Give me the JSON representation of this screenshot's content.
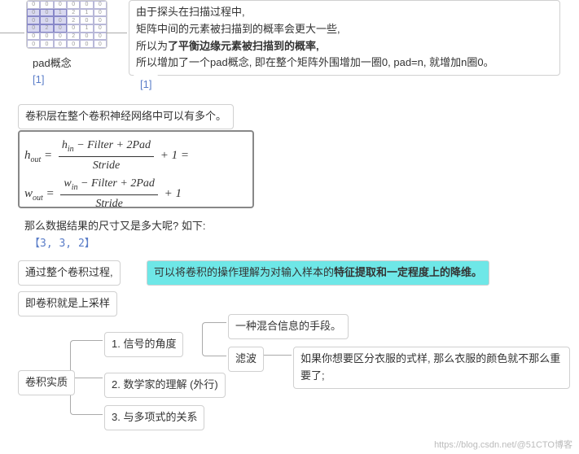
{
  "pad": {
    "label": "pad概念",
    "ref": "[1]",
    "ref2": "[1]"
  },
  "explanation": {
    "line1": "由于探头在扫描过程中,",
    "line2": "矩阵中间的元素被扫描到的概率会更大一些,",
    "line3_prefix": "所以为",
    "line3_bold": "了平衡边缘元素被扫描到的概率,",
    "line4": "所以增加了一个pad概念, 即在整个矩阵外围增加一圈0, pad=n, 就增加n圈0。"
  },
  "statement1": "卷积层在整个卷积神经网络中可以有多个。",
  "formula": {
    "h_lhs": "h",
    "h_sub": "out",
    "h_num_a": "h",
    "h_num_sub": "in",
    "h_num_rest": " − Filter + 2Pad",
    "h_den": "Stride",
    "h_tail": " + 1 =",
    "w_lhs": "w",
    "w_sub": "out",
    "w_num_a": "w",
    "w_num_sub": "in",
    "w_num_rest": " − Filter + 2Pad",
    "w_den": "Stride",
    "w_tail": " + 1"
  },
  "statement2": "那么数据结果的尺寸又是多大呢? 如下:",
  "result_array": "【3, 3, 2】",
  "statement3": "通过整个卷积过程,",
  "highlight_prefix": "可以将卷积的操作理解为对输入样本的",
  "highlight_bold": "特征提取和一定程度上的降维。",
  "statement4": "即卷积就是上采样",
  "tree": {
    "root": "卷积实质",
    "b1": "1. 信号的角度",
    "b2": "2. 数学家的理解 (外行)",
    "b3": "3. 与多项式的关系",
    "s1": "一种混合信息的手段。",
    "s2": "滤波",
    "s3": "如果你想要区分衣服的式样, 那么衣服的颜色就不那么重要了;"
  },
  "watermark": "https://blog.csdn.net/@51CTO博客"
}
